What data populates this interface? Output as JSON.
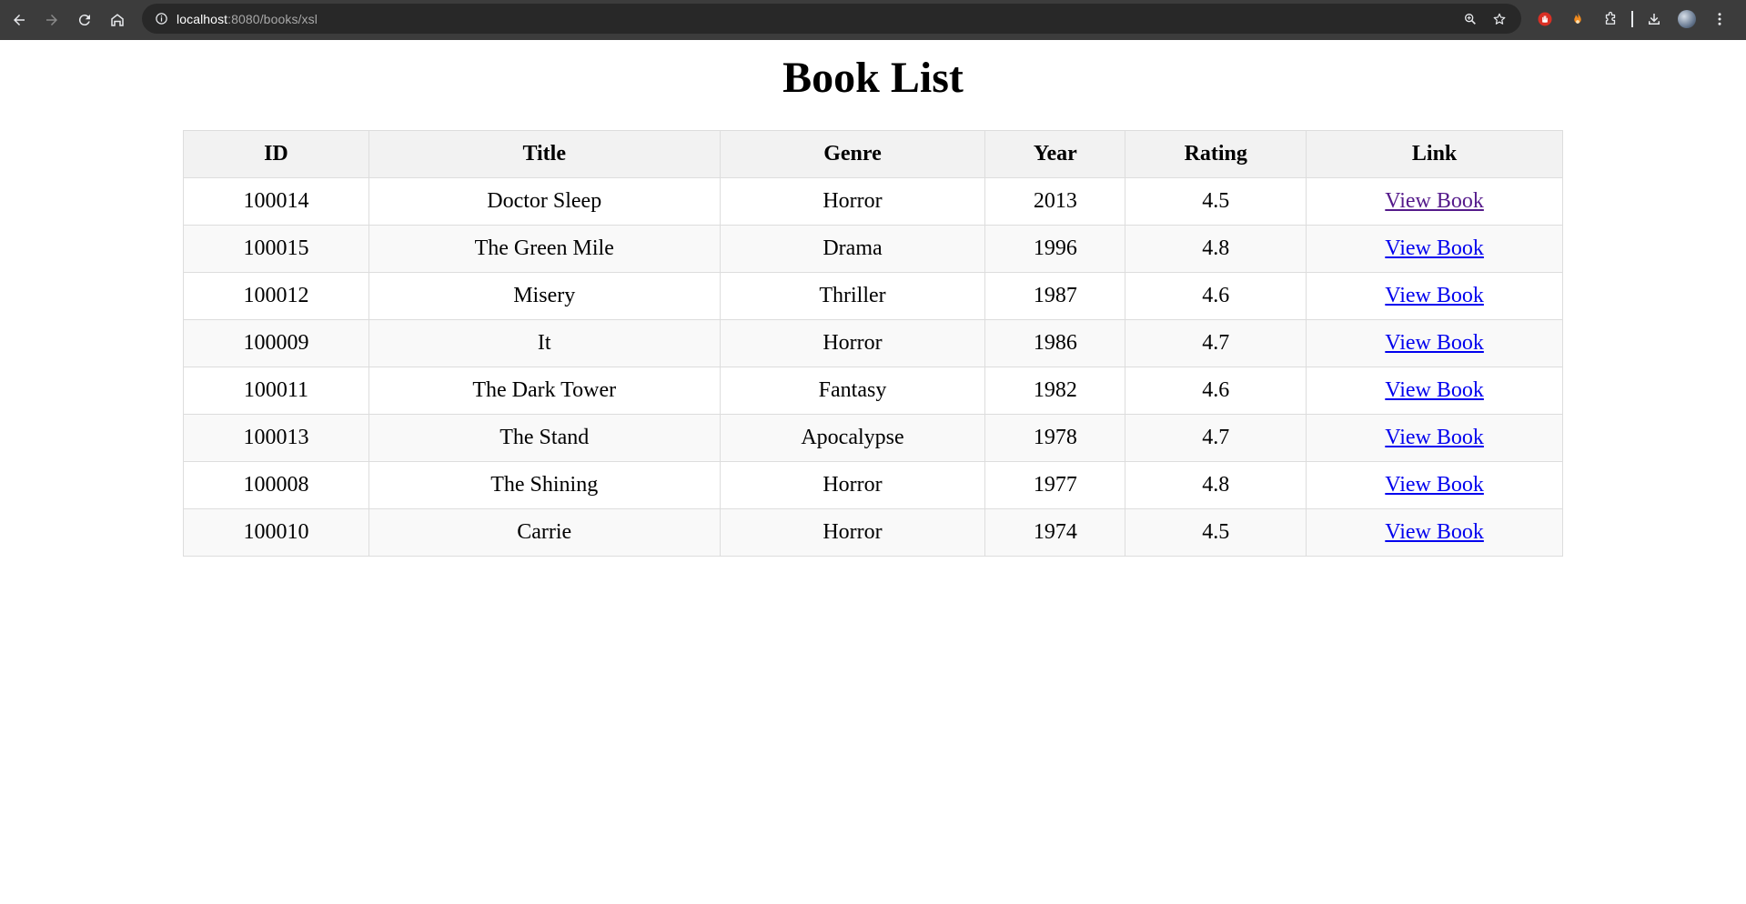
{
  "browser": {
    "url_host": "localhost",
    "url_rest": ":8080/books/xsl"
  },
  "page": {
    "title": "Book List"
  },
  "table": {
    "headers": [
      "ID",
      "Title",
      "Genre",
      "Year",
      "Rating",
      "Link"
    ],
    "rows": [
      {
        "id": "100014",
        "title": "Doctor Sleep",
        "genre": "Horror",
        "year": "2013",
        "rating": "4.5",
        "link": "View Book",
        "visited": true
      },
      {
        "id": "100015",
        "title": "The Green Mile",
        "genre": "Drama",
        "year": "1996",
        "rating": "4.8",
        "link": "View Book",
        "visited": false
      },
      {
        "id": "100012",
        "title": "Misery",
        "genre": "Thriller",
        "year": "1987",
        "rating": "4.6",
        "link": "View Book",
        "visited": false
      },
      {
        "id": "100009",
        "title": "It",
        "genre": "Horror",
        "year": "1986",
        "rating": "4.7",
        "link": "View Book",
        "visited": false
      },
      {
        "id": "100011",
        "title": "The Dark Tower",
        "genre": "Fantasy",
        "year": "1982",
        "rating": "4.6",
        "link": "View Book",
        "visited": false
      },
      {
        "id": "100013",
        "title": "The Stand",
        "genre": "Apocalypse",
        "year": "1978",
        "rating": "4.7",
        "link": "View Book",
        "visited": false
      },
      {
        "id": "100008",
        "title": "The Shining",
        "genre": "Horror",
        "year": "1977",
        "rating": "4.8",
        "link": "View Book",
        "visited": false
      },
      {
        "id": "100010",
        "title": "Carrie",
        "genre": "Horror",
        "year": "1974",
        "rating": "4.5",
        "link": "View Book",
        "visited": false
      }
    ]
  }
}
